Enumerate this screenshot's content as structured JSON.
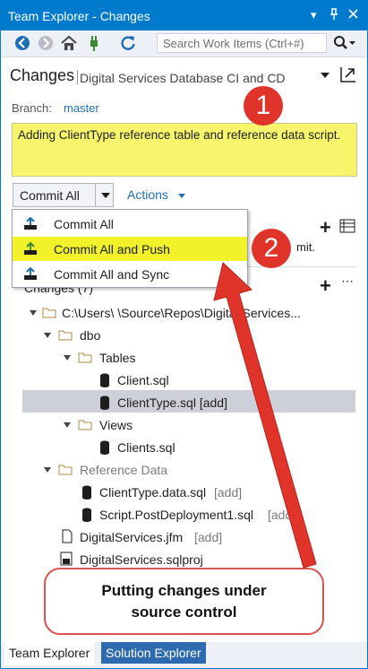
{
  "window": {
    "title": "Team Explorer - Changes",
    "pin": "▾ ⊓ ×"
  },
  "toolbar": {
    "search_placeholder": "Search Work Items (Ctrl+#)"
  },
  "header": {
    "title": "Changes",
    "subtitle": "Digital Services Database CI and CD"
  },
  "branch": {
    "label": "Branch:",
    "value": "master"
  },
  "commit_message": "Adding ClientType reference table and reference data script.",
  "buttons": {
    "commit_all": "Commit All",
    "actions": "Actions"
  },
  "menu": {
    "items": [
      {
        "label": "Commit All"
      },
      {
        "label": "Commit All and Push"
      },
      {
        "label": "Commit All and Sync"
      }
    ]
  },
  "behind_menu": {
    "commit_hint": "mit.",
    "changes_header": "Changes (7)"
  },
  "tree": {
    "root": "C:\\Users\\           \\Source\\Repos\\Digital Services...",
    "dbo": "dbo",
    "tables": "Tables",
    "client_sql": "Client.sql",
    "clienttype_sql": "ClientType.sql [add]",
    "views": "Views",
    "clients_sql": "Clients.sql",
    "reference_data": "Reference Data",
    "clienttype_data": "ClientType.data.sql",
    "clienttype_data_tag": "[add]",
    "script_post": "Script.PostDeployment1.sql",
    "script_post_tag": "[add",
    "jfm": "DigitalServices.jfm",
    "jfm_tag": "[add]",
    "sqlproj": "DigitalServices.sqlproj"
  },
  "annotations": {
    "badge1": "1",
    "badge2": "2",
    "callout_line1": "Putting changes under",
    "callout_line2": "source control"
  },
  "bottom_tabs": {
    "team_explorer": "Team Explorer",
    "solution_explorer": "Solution Explorer"
  },
  "colors": {
    "accent": "#007acc",
    "highlight": "#f2f22a",
    "annotation_red": "#e0342b"
  }
}
